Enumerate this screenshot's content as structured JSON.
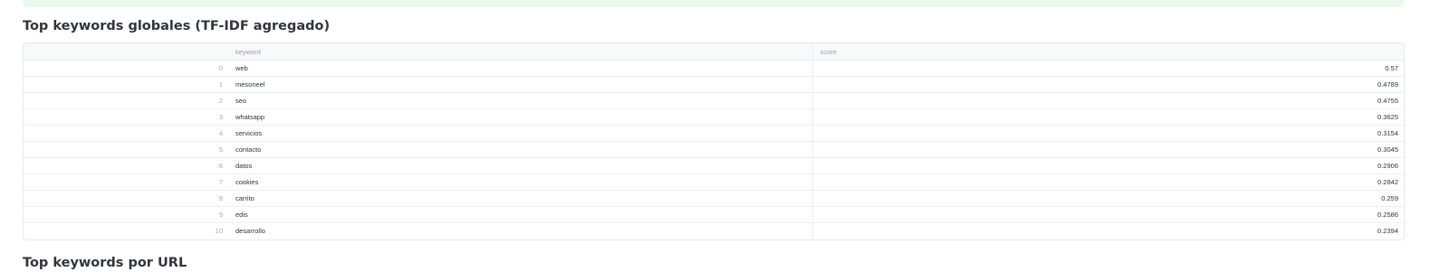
{
  "section_title": "Top keywords globales (TF-IDF agregado)",
  "next_section_title": "Top keywords por URL",
  "table": {
    "columns": [
      "keyword",
      "score"
    ],
    "rows": [
      {
        "index": "0",
        "keyword": "web",
        "score": "0.57"
      },
      {
        "index": "1",
        "keyword": "mesoneel",
        "score": "0.4789"
      },
      {
        "index": "2",
        "keyword": "seo",
        "score": "0.4755"
      },
      {
        "index": "3",
        "keyword": "whatsapp",
        "score": "0.3625"
      },
      {
        "index": "4",
        "keyword": "servicios",
        "score": "0.3154"
      },
      {
        "index": "5",
        "keyword": "contacto",
        "score": "0.3045"
      },
      {
        "index": "6",
        "keyword": "datos",
        "score": "0.2906"
      },
      {
        "index": "7",
        "keyword": "cookies",
        "score": "0.2842"
      },
      {
        "index": "8",
        "keyword": "carrito",
        "score": "0.259"
      },
      {
        "index": "9",
        "keyword": "edis",
        "score": "0.2586"
      },
      {
        "index": "10",
        "keyword": "desarrollo",
        "score": "0.2394"
      }
    ]
  },
  "colors": {
    "banner": "#e9f9ee",
    "text": "#31333f",
    "muted": "#9aa0aa",
    "border": "#e6e9ef"
  }
}
